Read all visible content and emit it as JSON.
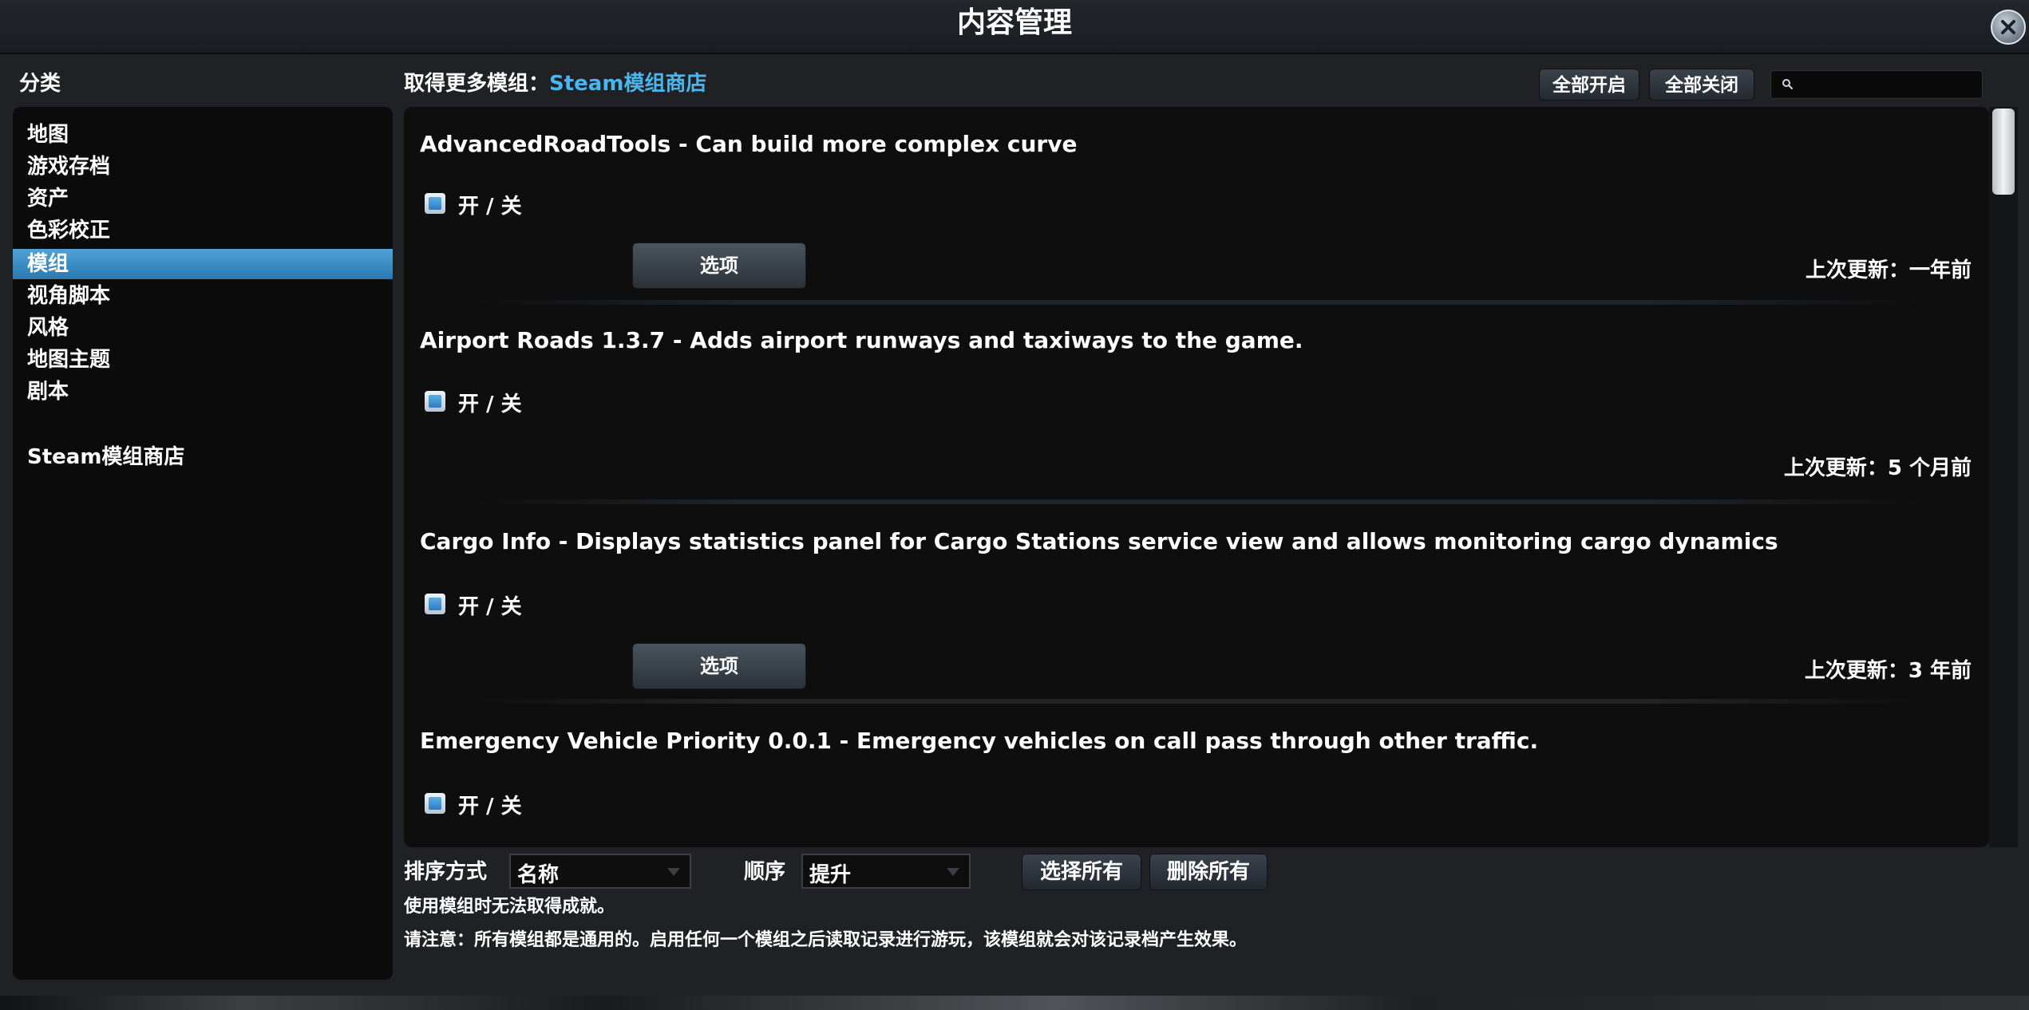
{
  "window": {
    "title": "内容管理"
  },
  "sidebar": {
    "header": "分类",
    "items": [
      {
        "label": "地图",
        "active": false
      },
      {
        "label": "游戏存档",
        "active": false
      },
      {
        "label": "资产",
        "active": false
      },
      {
        "label": "色彩校正",
        "active": false
      },
      {
        "label": "模组",
        "active": true
      },
      {
        "label": "视角脚本",
        "active": false
      },
      {
        "label": "风格",
        "active": false
      },
      {
        "label": "地图主题",
        "active": false
      },
      {
        "label": "剧本",
        "active": false
      }
    ],
    "steam_link": "Steam模组商店"
  },
  "toolbar": {
    "get_more_prefix": "取得更多模组：",
    "get_more_link": "Steam模组商店",
    "enable_all": "全部开启",
    "disable_all": "全部关闭",
    "search_placeholder": ""
  },
  "mods": [
    {
      "title": "AdvancedRoadTools - Can build more complex curve",
      "toggle_label": "开 / 关",
      "enabled": true,
      "options_label": "选项",
      "has_options": true,
      "updated": "上次更新：一年前"
    },
    {
      "title": "Airport Roads 1.3.7 - Adds airport runways and taxiways to the game.",
      "toggle_label": "开 / 关",
      "enabled": true,
      "options_label": "",
      "has_options": false,
      "updated": "上次更新：5 个月前"
    },
    {
      "title": "Cargo Info - Displays statistics panel for Cargo Stations service view and allows monitoring cargo dynamics",
      "toggle_label": "开 / 关",
      "enabled": true,
      "options_label": "选项",
      "has_options": true,
      "updated": "上次更新：3 年前"
    },
    {
      "title": "Emergency Vehicle Priority 0.0.1 - Emergency vehicles on call pass through other traffic.",
      "toggle_label": "开 / 关",
      "enabled": true,
      "options_label": "",
      "has_options": false,
      "updated": ""
    }
  ],
  "bottom": {
    "sort_label": "排序方式",
    "sort_value": "名称",
    "order_label": "顺序",
    "order_value": "提升",
    "select_all": "选择所有",
    "delete_all": "删除所有",
    "note1": "使用模组时无法取得成就。",
    "note2": "请注意：所有模组都是通用的。启用任何一个模组之后读取记录进行游玩，该模组就会对该记录档产生效果。"
  },
  "colors": {
    "accent": "#49b7ee",
    "active_item": "#3a8fc8"
  }
}
